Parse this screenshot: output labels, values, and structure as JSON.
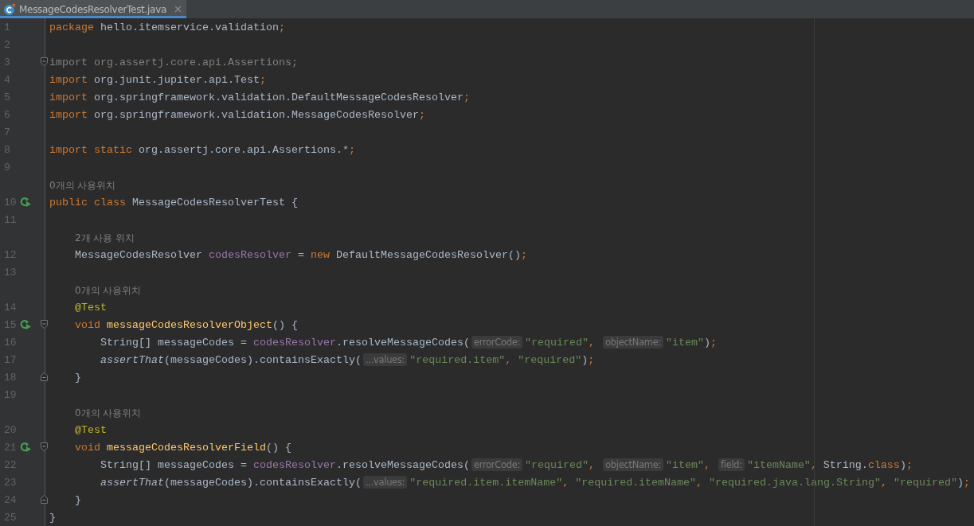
{
  "tabs": [
    {
      "title": "MessageCodesResolverTest.java",
      "selected": true,
      "closable": true
    }
  ],
  "rows": [
    {
      "number": "1",
      "tokens": [
        {
          "kind": "keyword",
          "s": "package"
        },
        {
          "kind": "plain",
          "s": " hello.itemservice.validation"
        },
        {
          "kind": "keyword",
          "s": ";"
        }
      ]
    },
    {
      "number": "2"
    },
    {
      "number": "3",
      "fold_open": true,
      "tokens": [
        {
          "kind": "unused",
          "s": "import org.assertj.core.api.Assertions;"
        }
      ]
    },
    {
      "number": "4",
      "tokens": [
        {
          "kind": "keyword",
          "s": "import"
        },
        {
          "kind": "plain",
          "s": " org.junit.jupiter.api.Test"
        },
        {
          "kind": "keyword",
          "s": ";"
        }
      ]
    },
    {
      "number": "5",
      "tokens": [
        {
          "kind": "keyword",
          "s": "import"
        },
        {
          "kind": "plain",
          "s": " org.springframework.validation.DefaultMessageCodesResolver"
        },
        {
          "kind": "keyword",
          "s": ";"
        }
      ]
    },
    {
      "number": "6",
      "tokens": [
        {
          "kind": "keyword",
          "s": "import"
        },
        {
          "kind": "plain",
          "s": " org.springframework.validation.MessageCodesResolver"
        },
        {
          "kind": "keyword",
          "s": ";"
        }
      ]
    },
    {
      "number": "7"
    },
    {
      "number": "8",
      "tokens": [
        {
          "kind": "keyword",
          "s": "import static"
        },
        {
          "kind": "plain",
          "s": " org.assertj.core.api.Assertions.*"
        },
        {
          "kind": "keyword",
          "s": ";"
        }
      ]
    },
    {
      "number": "9"
    },
    {
      "number": "10",
      "usage": "0개의 사용위치",
      "run": true,
      "tokens": [
        {
          "kind": "keyword",
          "s": "public class"
        },
        {
          "kind": "plain",
          "s": " MessageCodesResolverTest {"
        }
      ]
    },
    {
      "number": "11"
    },
    {
      "number": "12",
      "usage": "2개 사용 위치",
      "tokens": [
        {
          "kind": "plain",
          "s": "    MessageCodesResolver "
        },
        {
          "kind": "field",
          "s": "codesResolver"
        },
        {
          "kind": "plain",
          "s": " = "
        },
        {
          "kind": "keyword",
          "s": "new"
        },
        {
          "kind": "plain",
          "s": " DefaultMessageCodesResolver()"
        },
        {
          "kind": "keyword",
          "s": ";"
        }
      ]
    },
    {
      "number": "13"
    },
    {
      "number": "14",
      "usage": "0개의 사용위치",
      "tokens": [
        {
          "kind": "annotation",
          "s": "    @Test"
        }
      ]
    },
    {
      "number": "15",
      "run": true,
      "fold_open": true,
      "tokens": [
        {
          "kind": "keyword",
          "s": "    void "
        },
        {
          "kind": "declaration",
          "s": "messageCodesResolverObject"
        },
        {
          "kind": "plain",
          "s": "() {"
        }
      ]
    },
    {
      "number": "16",
      "tokens": [
        {
          "kind": "plain",
          "s": "        String[] messageCodes = "
        },
        {
          "kind": "field",
          "s": "codesResolver"
        },
        {
          "kind": "plain",
          "s": ".resolveMessageCodes("
        },
        {
          "kind": "hint",
          "s": "errorCode:"
        },
        {
          "kind": "string",
          "s": "\"required\""
        },
        {
          "kind": "keyword",
          "s": ", "
        },
        {
          "kind": "hint",
          "s": "objectName:"
        },
        {
          "kind": "string",
          "s": "\"item\""
        },
        {
          "kind": "plain",
          "s": ")"
        },
        {
          "kind": "keyword",
          "s": ";"
        }
      ]
    },
    {
      "number": "17",
      "tokens": [
        {
          "kind": "italic",
          "s": "        assertThat"
        },
        {
          "kind": "plain",
          "s": "(messageCodes).containsExactly("
        },
        {
          "kind": "hint",
          "s": "...values:"
        },
        {
          "kind": "string",
          "s": "\"required.item\""
        },
        {
          "kind": "keyword",
          "s": ", "
        },
        {
          "kind": "string",
          "s": "\"required\""
        },
        {
          "kind": "plain",
          "s": ")"
        },
        {
          "kind": "keyword",
          "s": ";"
        }
      ]
    },
    {
      "number": "18",
      "fold_close": true,
      "tokens": [
        {
          "kind": "plain",
          "s": "    }"
        }
      ]
    },
    {
      "number": "19"
    },
    {
      "number": "20",
      "usage": "0개의 사용위치",
      "tokens": [
        {
          "kind": "annotation",
          "s": "    @Test"
        }
      ]
    },
    {
      "number": "21",
      "run": true,
      "fold_open": true,
      "tokens": [
        {
          "kind": "keyword",
          "s": "    void "
        },
        {
          "kind": "declaration",
          "s": "messageCodesResolverField"
        },
        {
          "kind": "plain",
          "s": "() {"
        }
      ]
    },
    {
      "number": "22",
      "tokens": [
        {
          "kind": "plain",
          "s": "        String[] messageCodes = "
        },
        {
          "kind": "field",
          "s": "codesResolver"
        },
        {
          "kind": "plain",
          "s": ".resolveMessageCodes("
        },
        {
          "kind": "hint",
          "s": "errorCode:"
        },
        {
          "kind": "string",
          "s": "\"required\""
        },
        {
          "kind": "keyword",
          "s": ", "
        },
        {
          "kind": "hint",
          "s": "objectName:"
        },
        {
          "kind": "string",
          "s": "\"item\""
        },
        {
          "kind": "keyword",
          "s": ", "
        },
        {
          "kind": "hint",
          "s": "field:"
        },
        {
          "kind": "string",
          "s": "\"itemName\""
        },
        {
          "kind": "keyword",
          "s": ","
        },
        {
          "kind": "plain",
          "s": " String."
        },
        {
          "kind": "keyword",
          "s": "class"
        },
        {
          "kind": "plain",
          "s": ")"
        },
        {
          "kind": "keyword",
          "s": ";"
        }
      ]
    },
    {
      "number": "23",
      "tokens": [
        {
          "kind": "italic",
          "s": "        assertThat"
        },
        {
          "kind": "plain",
          "s": "(messageCodes).containsExactly("
        },
        {
          "kind": "hint",
          "s": "...values:"
        },
        {
          "kind": "string",
          "s": "\"required.item.itemName\""
        },
        {
          "kind": "keyword",
          "s": ", "
        },
        {
          "kind": "string",
          "s": "\"required.itemName\""
        },
        {
          "kind": "keyword",
          "s": ", "
        },
        {
          "kind": "string",
          "s": "\"required.java.lang.String\""
        },
        {
          "kind": "keyword",
          "s": ", "
        },
        {
          "kind": "string",
          "s": "\"required\""
        },
        {
          "kind": "plain",
          "s": ")"
        },
        {
          "kind": "keyword",
          "s": ";"
        }
      ]
    },
    {
      "number": "24",
      "fold_close": true,
      "tokens": [
        {
          "kind": "plain",
          "s": "    }"
        }
      ]
    },
    {
      "number": "25",
      "tokens": [
        {
          "kind": "plain",
          "s": "}"
        }
      ]
    }
  ]
}
